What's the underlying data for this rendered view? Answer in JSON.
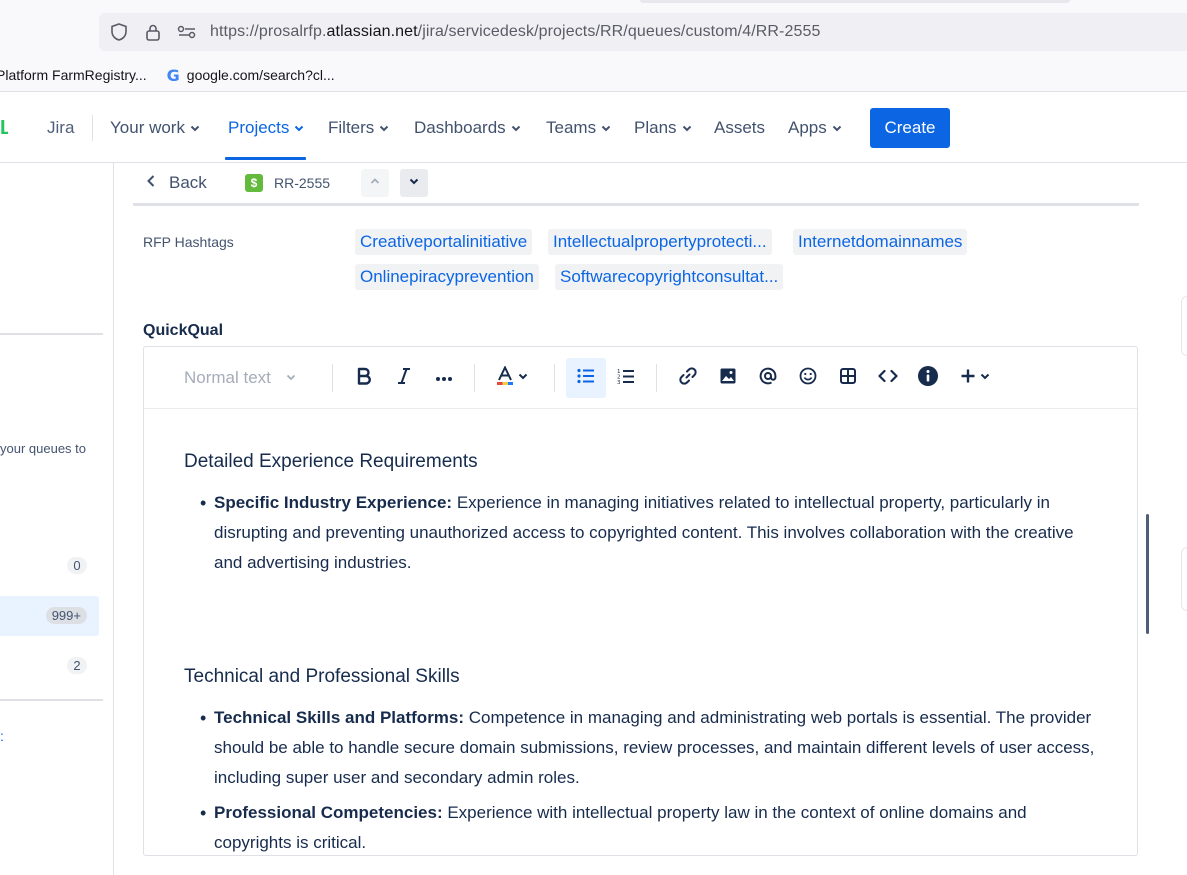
{
  "browser": {
    "url_prefix": "https://prosalrfp.",
    "url_domain": "atlassian.net",
    "url_path": "/jira/servicedesk/projects/RR/queues/custom/4/RR-2555",
    "bookmarks": [
      {
        "label": "Platform FarmRegistry..."
      },
      {
        "label": "google.com/search?cl..."
      }
    ]
  },
  "nav": {
    "product": "Jira",
    "items": [
      {
        "label": "Your work"
      },
      {
        "label": "Projects"
      },
      {
        "label": "Filters"
      },
      {
        "label": "Dashboards"
      },
      {
        "label": "Teams"
      },
      {
        "label": "Plans"
      },
      {
        "label": "Assets"
      },
      {
        "label": "Apps"
      }
    ],
    "create_label": "Create"
  },
  "sidebar": {
    "queues_hint": "your queues to",
    "counts": [
      "0",
      "999+",
      "2"
    ]
  },
  "issue": {
    "back_label": "Back",
    "type_icon": "$",
    "key": "RR-2555"
  },
  "fields": {
    "hashtags_label": "RFP Hashtags",
    "hashtags": [
      "Creativeportalinitiative",
      "Intellectualpropertyprotecti...",
      "Internetdomainnames",
      "Onlinepiracyprevention",
      "Softwarecopyrightconsultat..."
    ],
    "quickqual_label": "QuickQual"
  },
  "editor": {
    "text_style": "Normal text",
    "sections": [
      {
        "heading": "Detailed Experience Requirements",
        "bullets": [
          {
            "term": "Specific Industry Experience:",
            "text": " Experience in managing initiatives related to intellectual property, particularly in disrupting and preventing unauthorized access to copyrighted content. This involves collaboration with the creative and advertising industries."
          }
        ]
      },
      {
        "heading": "Technical and Professional Skills",
        "bullets": [
          {
            "term": "Technical Skills and Platforms:",
            "text": " Competence in managing and administrating web portals is essential. The provider should be able to handle secure domain submissions, review processes, and maintain different levels of user access, including super user and secondary admin roles."
          },
          {
            "term": "Professional Competencies:",
            "text": " Experience with intellectual property law in the context of online domains and copyrights is critical."
          }
        ]
      }
    ]
  },
  "colors": {
    "primary": "#0c66e4",
    "text": "#172b4d",
    "subtle": "#44546f",
    "issue_type": "#63ba3c"
  }
}
